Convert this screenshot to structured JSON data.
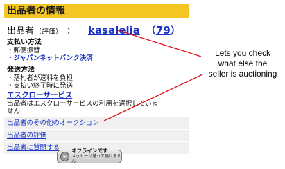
{
  "panel": {
    "title": "出品者の情報",
    "seller": {
      "key_label": "出品者",
      "sub_label": "（評価）",
      "colon": "：",
      "name": "kasalelia",
      "rating_open": "（",
      "rating": "79",
      "rating_close": "）"
    },
    "payment": {
      "heading": "支払い方法",
      "items": [
        "・郵便振替",
        "・ジャパンネットバンク決済"
      ]
    },
    "shipping": {
      "heading": "発送方法",
      "items": [
        "・落札者が送料を負担",
        "・支払い終了時に発送"
      ]
    },
    "escrow": {
      "heading": "エスクローサービス",
      "lines": [
        "出品者はエスクローサービスの利用を選択していま",
        "せん"
      ]
    },
    "links": {
      "other_auctions": "出品者のその他のオークション",
      "rating": "出品者の評価",
      "ask": "出品者に質問する"
    },
    "offline_button": {
      "main": "オフラインです",
      "sub": "メッセージ送って頂けません"
    }
  },
  "annotation": {
    "lines": [
      "Lets you check",
      "what else the",
      "seller is auctioning"
    ]
  },
  "colors": {
    "title_bar": "#f3c623",
    "link": "#1a35c4",
    "arrow": "#e0101a"
  }
}
